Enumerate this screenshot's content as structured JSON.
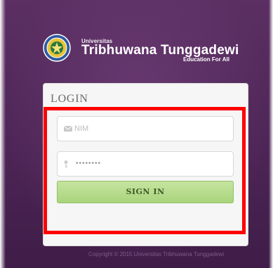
{
  "brand": {
    "university_label": "Universitas",
    "name": "Tribhuwana Tunggadewi",
    "tagline": "Education For All",
    "logo_icon": "university-seal-icon"
  },
  "login": {
    "title": "LOGIN",
    "nim_placeholder": "NIM",
    "nim_icon": "envelope-icon",
    "password_value": "••••••••",
    "password_icon": "key-icon",
    "signin_label": "SIGN IN"
  },
  "footer": {
    "copyright": "Copyright © 2015 Universitas Tribhuwana Tunggadewi"
  },
  "colors": {
    "background": "#4d2556",
    "panel": "#f6f6f6",
    "signin_button": "#b5db8c",
    "highlight": "#ff0000"
  }
}
